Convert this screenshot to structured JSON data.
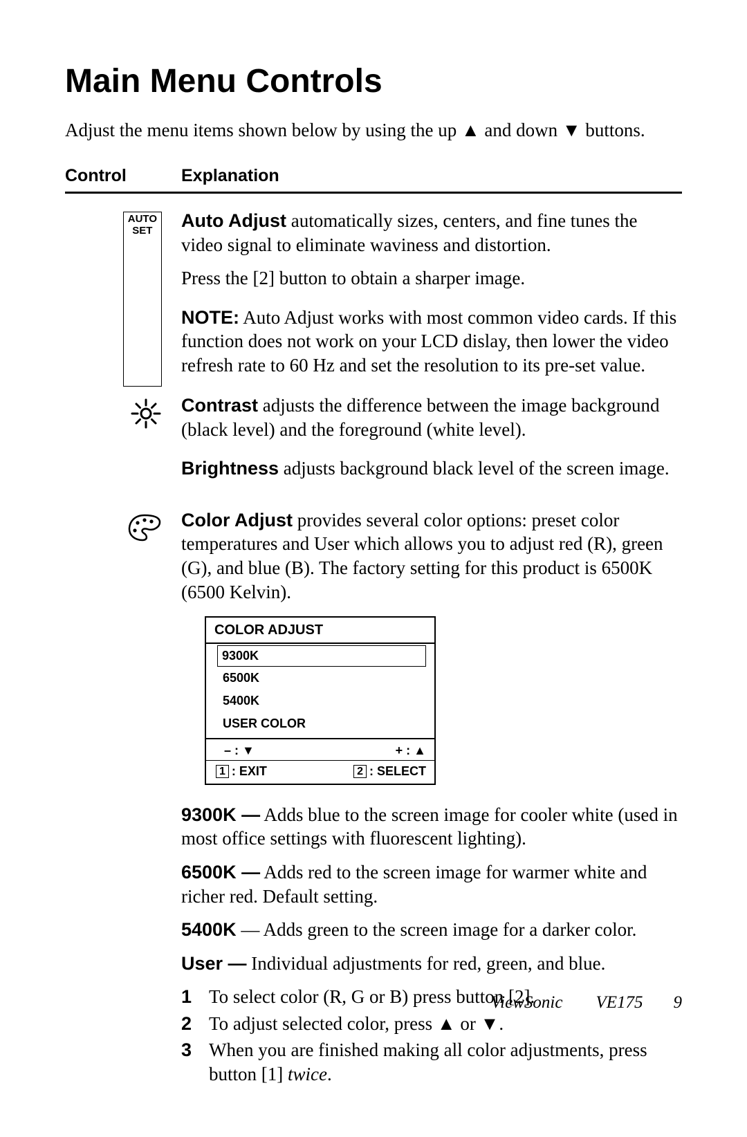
{
  "heading": "Main Menu Controls",
  "intro": "Adjust the menu items shown below by using the up ▲ and down ▼ buttons.",
  "tableHead": {
    "c1": "Control",
    "c2": "Explanation"
  },
  "autoset": {
    "l1": "AUTO",
    "l2": "SET"
  },
  "auto": {
    "label": "Auto  Adjust",
    "body": " automatically sizes, centers, and fine tunes the video signal to eliminate waviness and distortion.",
    "press": "Press the [2] button to obtain a sharper image.",
    "noteLabel": "NOTE:",
    "noteBody": " Auto Adjust works with most common video cards. If this function does not work on your LCD dislay, then lower the video refresh rate to 60 Hz and set the resolution to its pre-set value."
  },
  "contrast": {
    "label": "Contrast",
    "body": " adjusts the difference between the image background (black level) and the foreground (white level)."
  },
  "brightness": {
    "label": "Brightness",
    "body": " adjusts background black level of the screen image."
  },
  "color": {
    "label": "Color Adjust",
    "body": " provides several color options: preset color temperatures and User which allows you to adjust red (R), green (G), and blue (B). The factory setting for this product is 6500K (6500 Kelvin)."
  },
  "osd": {
    "title": "COLOR ADJUST",
    "items": [
      "9300K",
      "6500K",
      "5400K",
      "USER COLOR"
    ],
    "navMinus": "–  : ▼",
    "navPlus": "+ : ▲",
    "btn1": "1",
    "btn1Label": ": EXIT",
    "btn2": "2",
    "btn2Label": ": SELECT"
  },
  "temps": {
    "k9300L": "9300K —",
    "k9300": " Adds blue to the screen image for cooler white (used in most office settings with fluorescent lighting).",
    "k6500L": "6500K —",
    "k6500": " Adds red to the screen image for warmer white and richer red. Default setting.",
    "k5400L": "5400K",
    "k5400": " — Adds green to the screen image for a darker color.",
    "userL": "User —",
    "user": " Individual adjustments for red, green, and blue."
  },
  "steps": {
    "s1": "To select color (R, G or B) press button [2].",
    "s2": "To adjust selected color, press ▲ or ▼.",
    "s3a": "When you are finished making all color adjustments, press button [1] ",
    "s3b": "twice",
    "s3c": "."
  },
  "footer": {
    "brand": "ViewSonic",
    "model": "VE175",
    "page": "9"
  }
}
